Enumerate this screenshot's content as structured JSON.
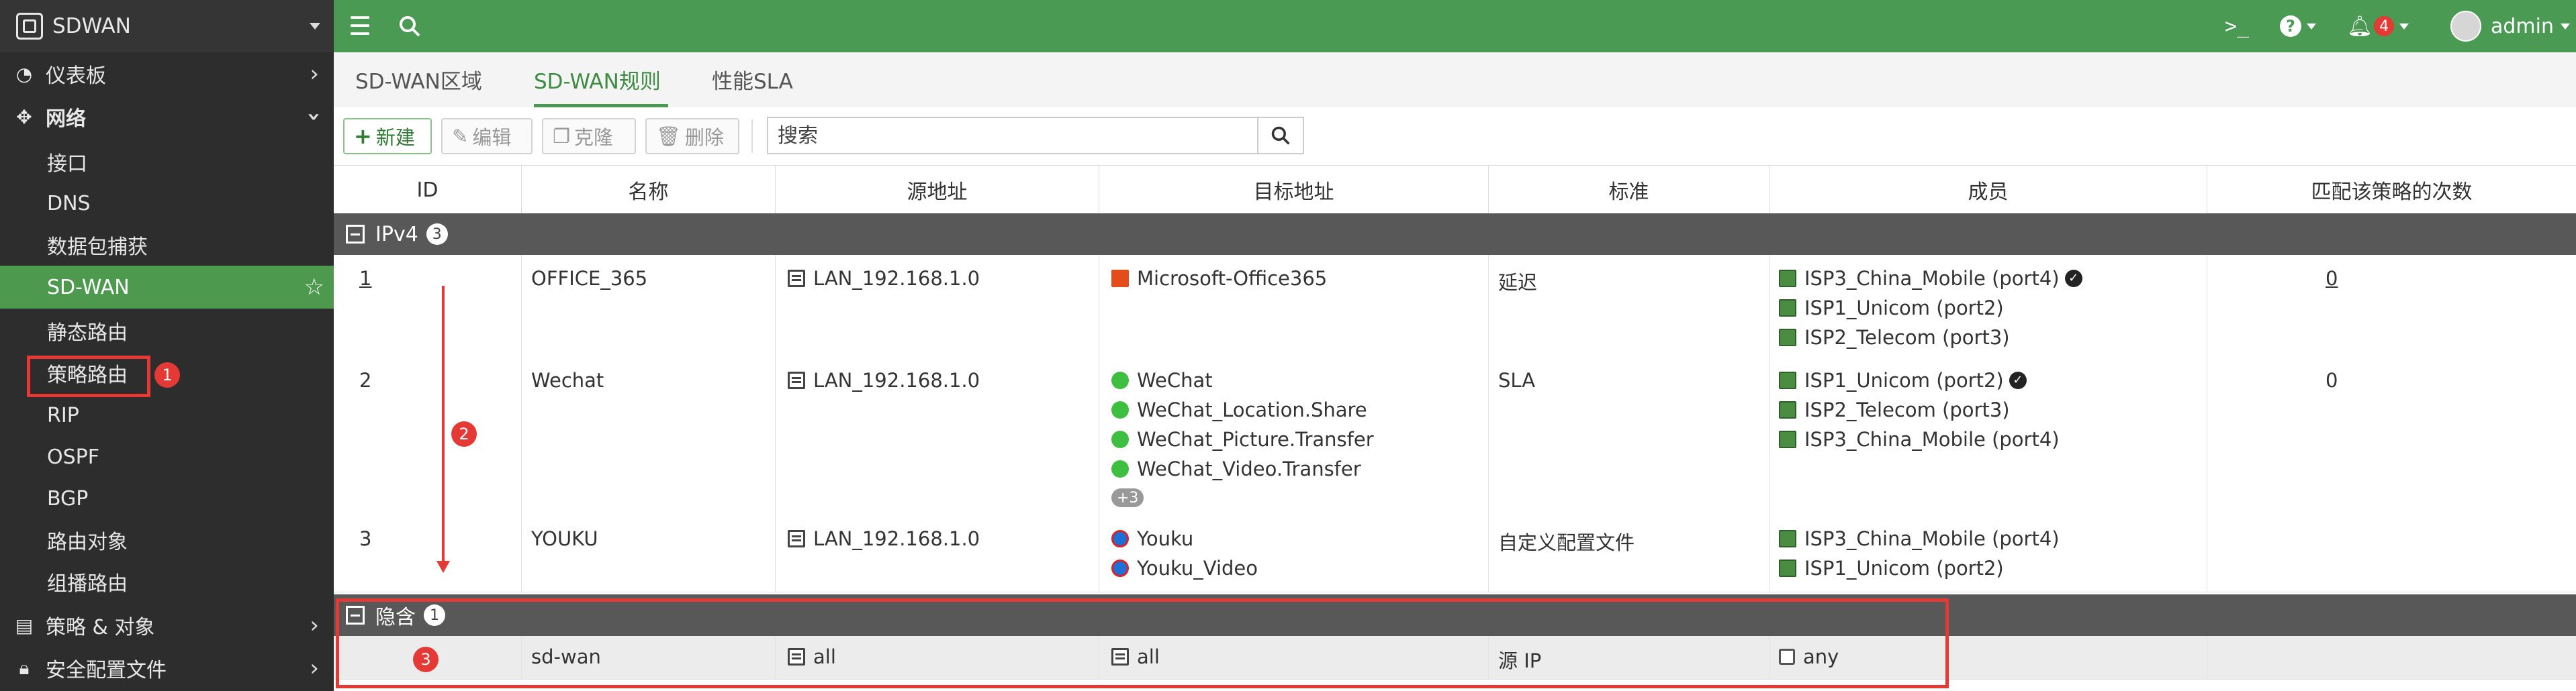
{
  "app": {
    "brand": "SDWAN"
  },
  "sidebar": {
    "items": [
      {
        "label": "仪表板",
        "icon": "dashboard-icon"
      },
      {
        "label": "网络",
        "icon": "network-icon"
      },
      {
        "label": "策略 & 对象",
        "icon": "policy-icon"
      },
      {
        "label": "安全配置文件",
        "icon": "lock-icon"
      }
    ],
    "network_sub": [
      "接口",
      "DNS",
      "数据包捕获",
      "SD-WAN",
      "静态路由",
      "策略路由",
      "RIP",
      "OSPF",
      "BGP",
      "路由对象",
      "组播路由"
    ]
  },
  "topbar": {
    "notification_count": "4",
    "user": "admin"
  },
  "tabs": [
    "SD-WAN区域",
    "SD-WAN规则",
    "性能SLA"
  ],
  "toolbar": {
    "new": "新建",
    "edit": "编辑",
    "clone": "克隆",
    "delete": "删除",
    "search_placeholder": "搜索"
  },
  "table": {
    "columns": [
      "ID",
      "名称",
      "源地址",
      "目标地址",
      "标准",
      "成员",
      "匹配该策略的次数"
    ],
    "groups": {
      "ipv4": {
        "label": "IPv4",
        "count": "3"
      },
      "implicit": {
        "label": "隐含",
        "count": "1"
      }
    },
    "rows": [
      {
        "id": "1",
        "name": "OFFICE_365",
        "src": "LAN_192.168.1.0",
        "dst": [
          "Microsoft-Office365"
        ],
        "criteria": "延迟",
        "members": [
          "ISP3_China_Mobile (port4)",
          "ISP1_Unicom (port2)",
          "ISP2_Telecom (port3)"
        ],
        "hits": "0"
      },
      {
        "id": "2",
        "name": "Wechat",
        "src": "LAN_192.168.1.0",
        "dst": [
          "WeChat",
          "WeChat_Location.Share",
          "WeChat_Picture.Transfer",
          "WeChat_Video.Transfer"
        ],
        "dst_more": "+3",
        "criteria": "SLA",
        "members": [
          "ISP1_Unicom (port2)",
          "ISP2_Telecom (port3)",
          "ISP3_China_Mobile (port4)"
        ],
        "hits": "0"
      },
      {
        "id": "3",
        "name": "YOUKU",
        "src": "LAN_192.168.1.0",
        "dst": [
          "Youku",
          "Youku_Video"
        ],
        "criteria": "自定义配置文件",
        "members": [
          "ISP3_China_Mobile (port4)",
          "ISP1_Unicom (port2)"
        ],
        "hits": ""
      }
    ],
    "implicit_row": {
      "name": "sd-wan",
      "src": "all",
      "dst": "all",
      "criteria": "源 IP",
      "members": "any"
    }
  },
  "annotations": [
    "1",
    "2",
    "3"
  ],
  "colors": {
    "accent": "#4a9a54",
    "annotation": "#e53935",
    "sidebar": "#2d2d2d"
  }
}
